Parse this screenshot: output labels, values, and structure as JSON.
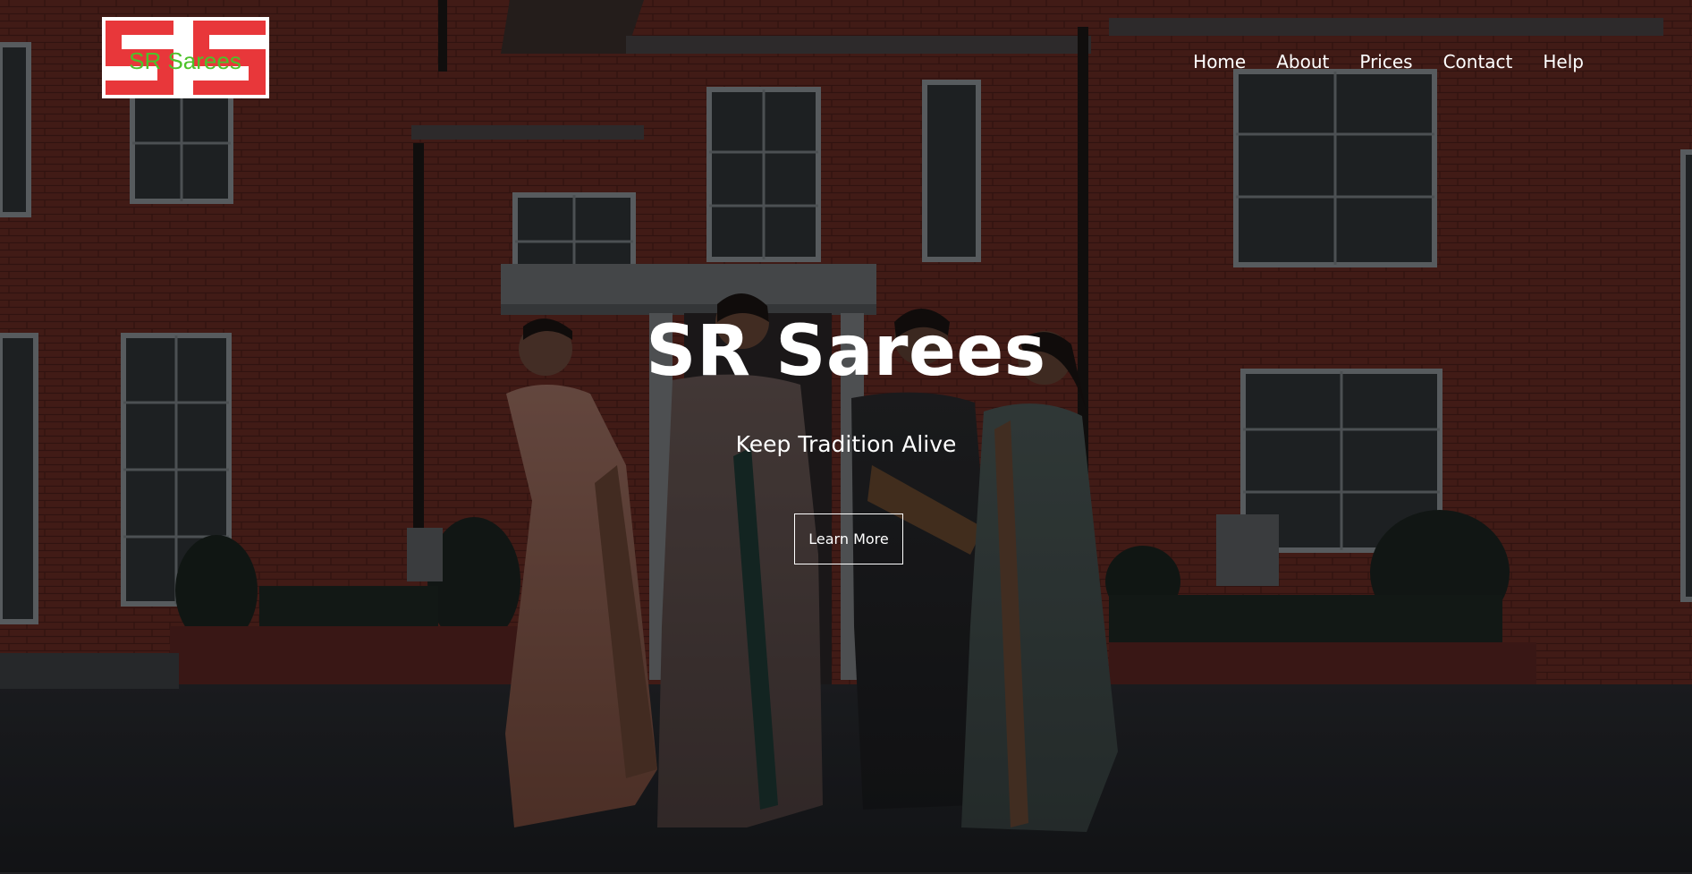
{
  "logo": {
    "text": "SR Sarees",
    "letters": "SS",
    "letter_color": "#e8373a",
    "text_color": "#4cc22a",
    "background": "#ffffff"
  },
  "nav": {
    "items": [
      {
        "label": "Home"
      },
      {
        "label": "About"
      },
      {
        "label": "Prices"
      },
      {
        "label": "Contact"
      },
      {
        "label": "Help"
      }
    ]
  },
  "hero": {
    "title": "SR Sarees",
    "subtitle": "Keep Tradition Alive",
    "cta_label": "Learn More",
    "background_description_icon": "photo-background",
    "overlay_color": "#000000"
  }
}
